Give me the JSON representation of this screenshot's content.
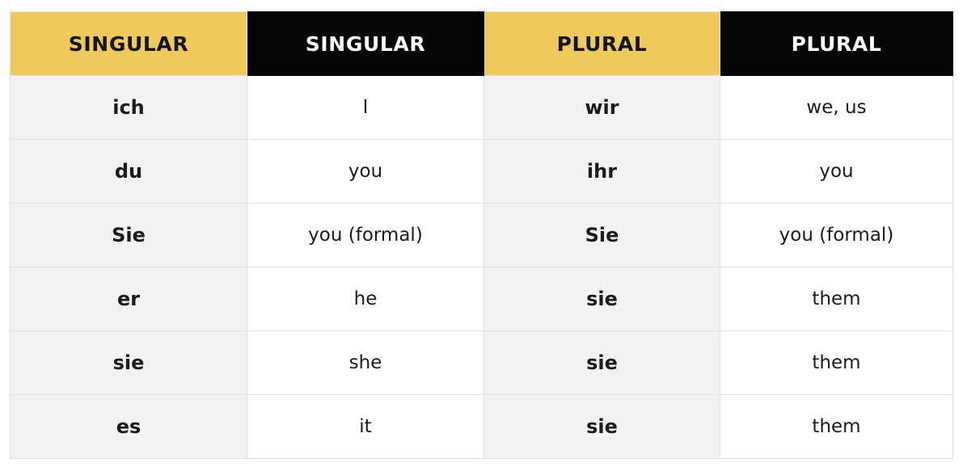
{
  "table": {
    "name": "german-personal-pronouns",
    "colors": {
      "header_gold_bg": "#efc95c",
      "header_gold_text": "#151515",
      "header_dark_bg": "#060606",
      "header_dark_text": "#ffffff",
      "term_cell_bg": "#f2f2f2",
      "gloss_cell_bg": "#ffffff",
      "body_text": "#1b1b1b",
      "grid_line": "#e3e3e3",
      "page_bg": "#ffffff"
    },
    "headers": [
      {
        "label": "SINGULAR",
        "style": "gold"
      },
      {
        "label": "SINGULAR",
        "style": "dark"
      },
      {
        "label": "PLURAL",
        "style": "gold"
      },
      {
        "label": "PLURAL",
        "style": "dark"
      }
    ],
    "rows": [
      {
        "singular_term": "ich",
        "singular_gloss": "I",
        "plural_term": "wir",
        "plural_gloss": "we, us"
      },
      {
        "singular_term": "du",
        "singular_gloss": "you",
        "plural_term": "ihr",
        "plural_gloss": "you"
      },
      {
        "singular_term": "Sie",
        "singular_gloss": "you (formal)",
        "plural_term": "Sie",
        "plural_gloss": "you (formal)"
      },
      {
        "singular_term": "er",
        "singular_gloss": "he",
        "plural_term": "sie",
        "plural_gloss": "them"
      },
      {
        "singular_term": "sie",
        "singular_gloss": "she",
        "plural_term": "sie",
        "plural_gloss": "them"
      },
      {
        "singular_term": "es",
        "singular_gloss": "it",
        "plural_term": "sie",
        "plural_gloss": "them"
      }
    ]
  }
}
